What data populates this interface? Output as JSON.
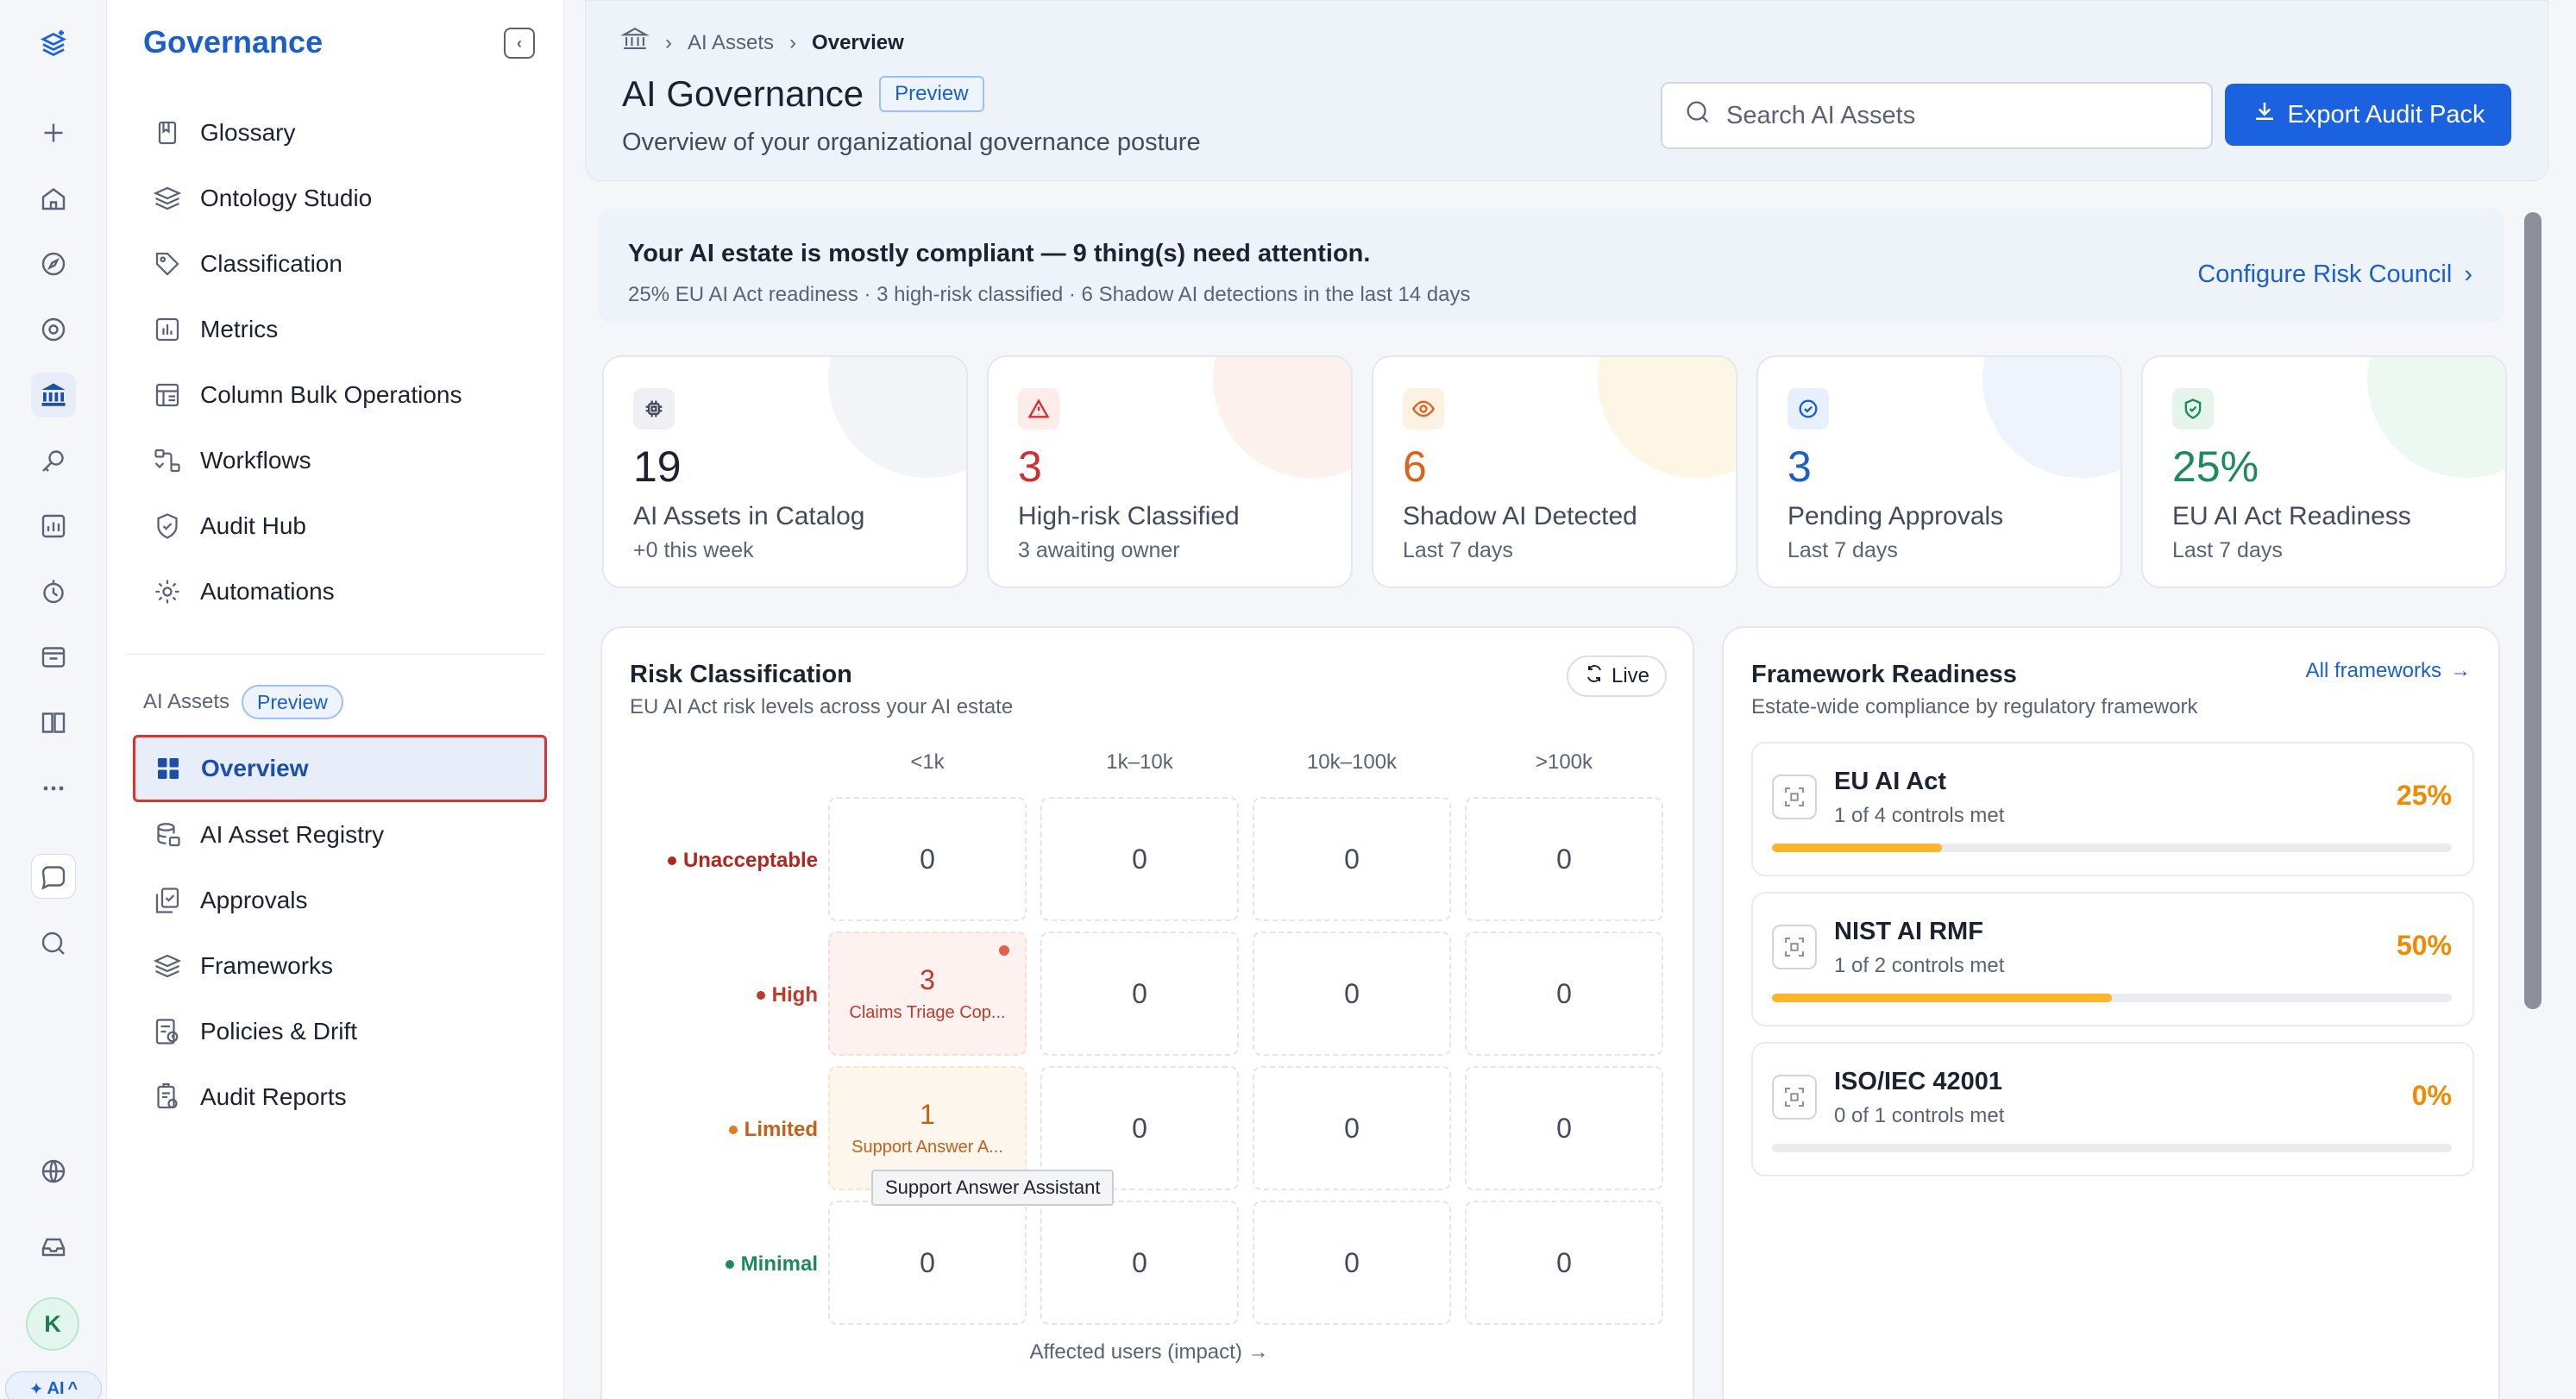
{
  "rail": {
    "avatar_initial": "K",
    "ai_label": "AI"
  },
  "menu": {
    "title": "Governance",
    "items": [
      {
        "label": "Glossary",
        "icon": "book-icon"
      },
      {
        "label": "Ontology Studio",
        "icon": "layers-icon"
      },
      {
        "label": "Classification",
        "icon": "tag-icon"
      },
      {
        "label": "Metrics",
        "icon": "bar-chart-icon"
      },
      {
        "label": "Column Bulk Operations",
        "icon": "table-icon"
      },
      {
        "label": "Workflows",
        "icon": "workflow-icon"
      },
      {
        "label": "Audit Hub",
        "icon": "shield-check-icon"
      },
      {
        "label": "Automations",
        "icon": "automation-gear-icon"
      }
    ],
    "section_label": "AI Assets",
    "section_badge": "Preview",
    "ai_items": [
      {
        "label": "Overview",
        "icon": "grid-icon",
        "active": true
      },
      {
        "label": "AI Asset Registry",
        "icon": "database-icon"
      },
      {
        "label": "Approvals",
        "icon": "approval-icon"
      },
      {
        "label": "Frameworks",
        "icon": "stack-icon"
      },
      {
        "label": "Policies & Drift",
        "icon": "policy-icon"
      },
      {
        "label": "Audit Reports",
        "icon": "report-icon"
      }
    ]
  },
  "header": {
    "breadcrumbs": [
      "AI Assets",
      "Overview"
    ],
    "title": "AI Governance",
    "badge": "Preview",
    "subtitle": "Overview of your organizational governance posture",
    "search_placeholder": "Search AI Assets",
    "export_label": "Export Audit Pack"
  },
  "banner": {
    "headline": "Your AI estate is mostly compliant — 9 thing(s) need attention.",
    "detail": "25% EU AI Act readiness · 3 high-risk classified · 6 Shadow AI detections in the last 14 days",
    "link": "Configure Risk Council"
  },
  "kpis": [
    {
      "value": "19",
      "label": "AI Assets in Catalog",
      "sub": "+0 this week",
      "color": "#1d2230",
      "icon": "chip-icon"
    },
    {
      "value": "3",
      "label": "High-risk Classified",
      "sub": "3 awaiting owner",
      "color": "#d0312d",
      "icon": "warning-icon"
    },
    {
      "value": "6",
      "label": "Shadow AI Detected",
      "sub": "Last 7 days",
      "color": "#d9641a",
      "icon": "eye-icon"
    },
    {
      "value": "3",
      "label": "Pending Approvals",
      "sub": "Last 7 days",
      "color": "#1b5fc9",
      "icon": "check-circle-icon"
    },
    {
      "value": "25%",
      "label": "EU AI Act Readiness",
      "sub": "Last 7 days",
      "color": "#1c8a5a",
      "icon": "shield-icon"
    }
  ],
  "risk": {
    "title": "Risk Classification",
    "subtitle": "EU AI Act risk levels across your AI estate",
    "live_label": "Live",
    "columns": [
      "<1k",
      "1k–10k",
      "10k–100k",
      ">100k"
    ],
    "rows": [
      {
        "label": "Unacceptable",
        "color": "#b3261e",
        "cells": [
          "0",
          "0",
          "0",
          "0"
        ]
      },
      {
        "label": "High",
        "color": "#c0392b",
        "cells": [
          "3",
          "0",
          "0",
          "0"
        ],
        "first_note": "Claims Triage Cop..."
      },
      {
        "label": "Limited",
        "color": "#c4601a",
        "cells": [
          "1",
          "0",
          "0",
          "0"
        ],
        "first_note": "Support Answer A..."
      },
      {
        "label": "Minimal",
        "color": "#1c8a5a",
        "cells": [
          "0",
          "0",
          "0",
          "0"
        ]
      }
    ],
    "axis_label": "Affected users (impact) →",
    "tooltip": "Support Answer Assistant"
  },
  "frameworks": {
    "title": "Framework Readiness",
    "subtitle": "Estate-wide compliance by regulatory framework",
    "all_link": "All frameworks",
    "items": [
      {
        "name": "EU AI Act",
        "status": "1 of 4 controls met",
        "percent_label": "25%",
        "percent": 25
      },
      {
        "name": "NIST AI RMF",
        "status": "1 of 2 controls met",
        "percent_label": "50%",
        "percent": 50
      },
      {
        "name": "ISO/IEC 42001",
        "status": "0 of 1 controls met",
        "percent_label": "0%",
        "percent": 0
      }
    ]
  }
}
